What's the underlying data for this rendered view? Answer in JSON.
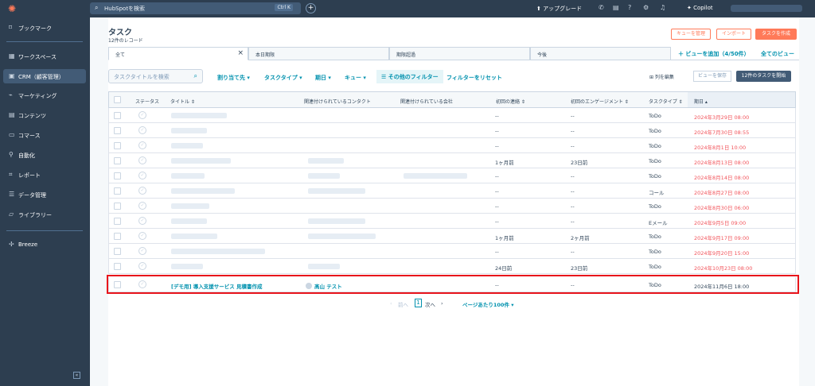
{
  "topbar": {
    "search_placeholder": "HubSpotを検索",
    "search_shortcut": "Ctrl K",
    "upgrade_label": "アップグレード",
    "copilot_label": "Copilot"
  },
  "sidebar": {
    "items": [
      {
        "label": "ブックマーク",
        "icon": "bookmark-icon"
      },
      {
        "label": "ワークスペース",
        "icon": "grid-icon"
      },
      {
        "label": "CRM（顧客管理）",
        "icon": "crm-icon"
      },
      {
        "label": "マーケティング",
        "icon": "megaphone-icon"
      },
      {
        "label": "コンテンツ",
        "icon": "content-icon"
      },
      {
        "label": "コマース",
        "icon": "commerce-icon"
      },
      {
        "label": "自動化",
        "icon": "automation-icon"
      },
      {
        "label": "レポート",
        "icon": "chart-icon"
      },
      {
        "label": "データ管理",
        "icon": "database-icon"
      },
      {
        "label": "ライブラリー",
        "icon": "folder-icon"
      },
      {
        "label": "Breeze",
        "icon": "sparkle-icon"
      }
    ]
  },
  "page": {
    "title": "タスク",
    "record_count": "12件のレコード",
    "buttons": {
      "manage_queue": "キューを管理",
      "import": "インポート",
      "create_task": "タスクを作成"
    }
  },
  "tabs": [
    {
      "label": "全て"
    },
    {
      "label": "本日期限"
    },
    {
      "label": "期限超過"
    },
    {
      "label": "今後"
    }
  ],
  "add_view": "＋ ビューを追加（4/50件）",
  "all_views": "全てのビュー",
  "filters": {
    "search_placeholder": "タスクタイトルを検索",
    "assignee": "割り当て先 ▾",
    "task_type": "タスクタイプ ▾",
    "due_date": "期日 ▾",
    "queue": "キュー ▾",
    "more": "☰ その他のフィルター",
    "reset": "フィルターをリセット",
    "edit_columns": "⊞ 列を編集",
    "save_view": "ビューを保存",
    "start_tasks": "12件のタスクを開始"
  },
  "table": {
    "headers": {
      "status": "ステータス",
      "title": "タイトル ⇕",
      "contact": "関連付けられているコンタクト",
      "company": "関連付けられている会社",
      "first_contact": "初回の連絡 ⇕",
      "first_engagement": "初回のエンゲージメント ⇕",
      "task_type": "タスクタイプ ⇕",
      "due_date": "期日 ▴"
    },
    "rows": [
      {
        "first_contact": "--",
        "first_engagement": "--",
        "type": "ToDo",
        "due": "2024年3月29日 08:00"
      },
      {
        "first_contact": "--",
        "first_engagement": "--",
        "type": "ToDo",
        "due": "2024年7月30日 08:55"
      },
      {
        "first_contact": "--",
        "first_engagement": "--",
        "type": "ToDo",
        "due": "2024年8月1日 10:00"
      },
      {
        "first_contact": "1ヶ月前",
        "first_engagement": "23日前",
        "type": "ToDo",
        "due": "2024年8月13日 08:00"
      },
      {
        "first_contact": "--",
        "first_engagement": "--",
        "type": "ToDo",
        "due": "2024年8月14日 08:00"
      },
      {
        "first_contact": "--",
        "first_engagement": "--",
        "type": "コール",
        "due": "2024年8月27日 08:00"
      },
      {
        "first_contact": "--",
        "first_engagement": "--",
        "type": "ToDo",
        "due": "2024年8月30日 06:00"
      },
      {
        "first_contact": "--",
        "first_engagement": "--",
        "type": "Eメール",
        "due": "2024年9月5日 09:00"
      },
      {
        "first_contact": "1ヶ月前",
        "first_engagement": "2ヶ月前",
        "type": "ToDo",
        "due": "2024年9月17日 09:00"
      },
      {
        "first_contact": "--",
        "first_engagement": "--",
        "type": "ToDo",
        "due": "2024年9月20日 15:00"
      },
      {
        "first_contact": "24日前",
        "first_engagement": "23日前",
        "type": "ToDo",
        "due": "2024年10月23日 08:00"
      }
    ],
    "highlighted_row": {
      "title": "[デモ用] 導入支援サービス 見積書作成",
      "contact": "髙山 テスト",
      "first_contact": "--",
      "first_engagement": "--",
      "type": "ToDo",
      "due": "2024年11月6日 18:00"
    }
  },
  "pagination": {
    "prev": "前へ",
    "page": "1",
    "next": "次へ",
    "per_page": "ページあたり100件 ▾"
  }
}
